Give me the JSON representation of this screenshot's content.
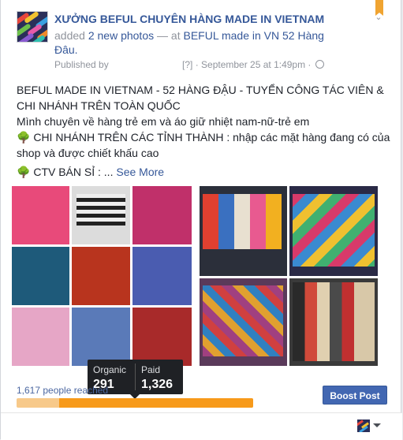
{
  "post": {
    "page_name": "XƯỞNG BEFUL CHUYÊN HÀNG MADE IN VIETNAM",
    "added_prefix": "added ",
    "added_link": "2 new photos",
    "added_middle": " — at ",
    "location_link": "BEFUL made in VN 52 Hàng Đâu.",
    "published_by": "Published by",
    "help_mark": "[?]",
    "date": "· September 25 at 1:49pm ·",
    "text": {
      "line1": "BEFUL MADE IN VIETNAM - 52 HÀNG ĐẬU - TUYỂN CÔNG TÁC VIÊN & CHI NHÁNH TRÊN TOÀN QUỐC",
      "line2": "Mình chuyên về hàng trẻ em và áo giữ nhiệt nam-nữ-trẻ em",
      "line3": " CHI NHÁNH TRÊN CÁC TỈNH THÀNH : nhập các mặt hàng đang có của shop và được chiết khấu cao",
      "line4": " CTV BÁN SỈ : ...",
      "see_more": "See More"
    }
  },
  "insights": {
    "organic_label": "Organic",
    "organic_value": "291",
    "paid_label": "Paid",
    "paid_value": "1,326",
    "reach_text": "1,617 people reached",
    "organic_fraction": 0.18,
    "boost_label": "Boost Post"
  },
  "icons": {
    "bookmark": "bookmark-icon",
    "chevron": "chevron-down-icon",
    "globe": "globe-icon",
    "tree": "tree-emoji",
    "caret": "caret-down-icon"
  },
  "colors": {
    "link": "#365899",
    "accent_orange": "#f79a1a",
    "boost_button": "#4267b2"
  }
}
